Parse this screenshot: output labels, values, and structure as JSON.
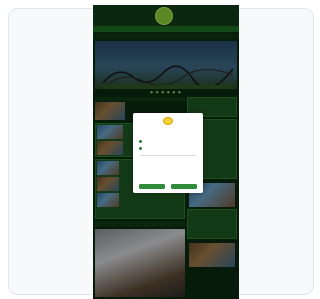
{
  "site": {
    "logo_text": "",
    "header_links": "",
    "nav": [
      "",
      "",
      "",
      "",
      "",
      ""
    ],
    "subbar": "",
    "hero_title": "",
    "dots": "● ● ● ● ● ●"
  },
  "content": {
    "left_blocks": [
      {
        "title": "",
        "body": ""
      },
      {
        "title": "",
        "body": ""
      },
      {
        "title": "",
        "body": ""
      },
      {
        "title": "",
        "body": ""
      }
    ],
    "right_blocks": [
      {
        "title": ""
      },
      {
        "title": ""
      },
      {
        "title": ""
      },
      {
        "title": ""
      }
    ]
  },
  "consent_modal": {
    "title": "",
    "options": [
      "",
      ""
    ],
    "input_placeholder": "",
    "body": "",
    "button_left": "",
    "button_right": ""
  },
  "colors": {
    "site_background": "#0c2a10",
    "nav_green": "#1e6f24",
    "accept_button": "#2e8b3a"
  }
}
